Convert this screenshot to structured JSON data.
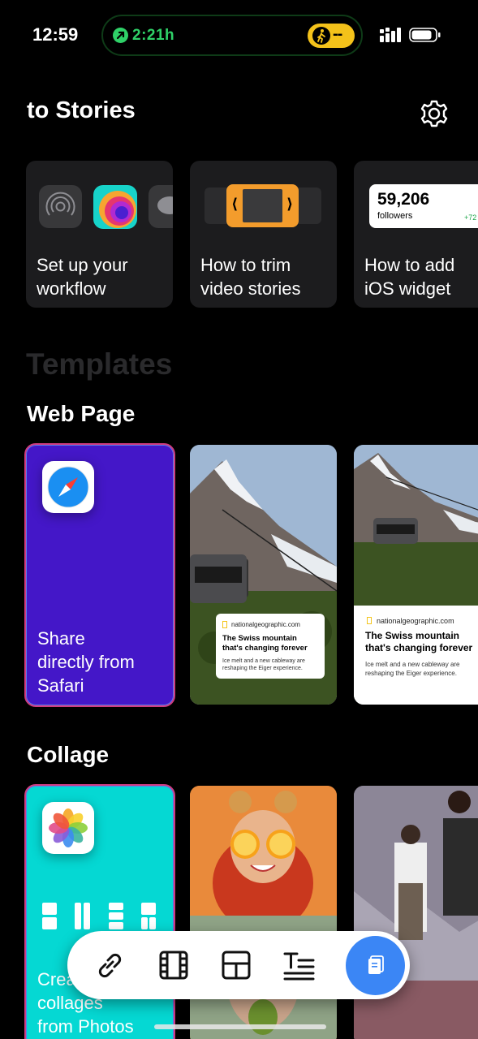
{
  "status_bar": {
    "time": "12:59",
    "live_activity_time": "2:21h",
    "walk_value": "--"
  },
  "header": {
    "title": "to Stories"
  },
  "guides": [
    {
      "label": "Set up your\nworkflow"
    },
    {
      "label": "How to trim\nvideo stories"
    },
    {
      "label": "How to add\niOS widget",
      "widget_count": "59,206",
      "widget_label": "followers",
      "widget_delta": "+72"
    }
  ],
  "sections": {
    "templates_ghost": "Templates",
    "web_page": "Web Page",
    "collage": "Collage"
  },
  "web_page_cards": {
    "safari_caption": "Share\ndirectly from\nSafari",
    "preview_1": {
      "domain": "nationalgeographic.com",
      "headline": "The Swiss mountain\nthat's changing forever",
      "subtitle": "Ice melt and a new cableway are\nreshaping the Eiger experience."
    },
    "preview_2": {
      "domain": "nationalgeographic.com",
      "headline": "The Swiss mountain\nthat's changing forever",
      "subtitle": "Ice melt and a new cableway are\nreshaping the Eiger experience."
    }
  },
  "collage_cards": {
    "photos_caption": "Create\ncollages\nfrom Photos"
  },
  "toolbar": {
    "icons": [
      "link-icon",
      "film-strip-icon",
      "layout-icon",
      "text-icon",
      "clipboard-icon"
    ]
  },
  "colors": {
    "accent_blue": "#3b86f5",
    "safari_card": "#4417c8",
    "photos_card": "#05d8d3",
    "live_green": "#2fd168",
    "card_bg": "#1c1c1e"
  }
}
